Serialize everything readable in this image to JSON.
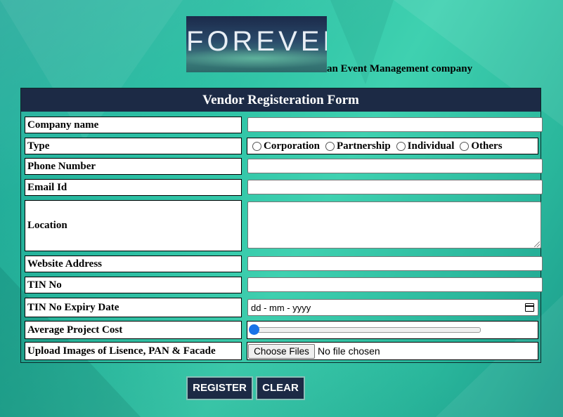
{
  "header": {
    "logo_text": "FOREVER",
    "tagline": "an Event Management company"
  },
  "form": {
    "title": "Vendor Registeration Form",
    "labels": {
      "company": "Company name",
      "type": "Type",
      "phone": "Phone Number",
      "email": "Email Id",
      "location": "Location",
      "website": "Website Address",
      "tin": "TIN No",
      "tin_expiry": "TIN No Expiry Date",
      "avg_cost": "Average Project Cost",
      "upload": "Upload Images of Lisence, PAN & Facade"
    },
    "type_options": [
      "Corporation",
      "Partnership",
      "Individual",
      "Others"
    ],
    "date_placeholder": "dd - mm - yyyy",
    "slider_value": 0,
    "file_button": "Choose Files",
    "file_status": "No file chosen"
  },
  "buttons": {
    "register": "REGISTER",
    "clear": "CLEAR"
  },
  "colors": {
    "header_bg": "#1c2a45",
    "background": "#2bbfa3"
  }
}
